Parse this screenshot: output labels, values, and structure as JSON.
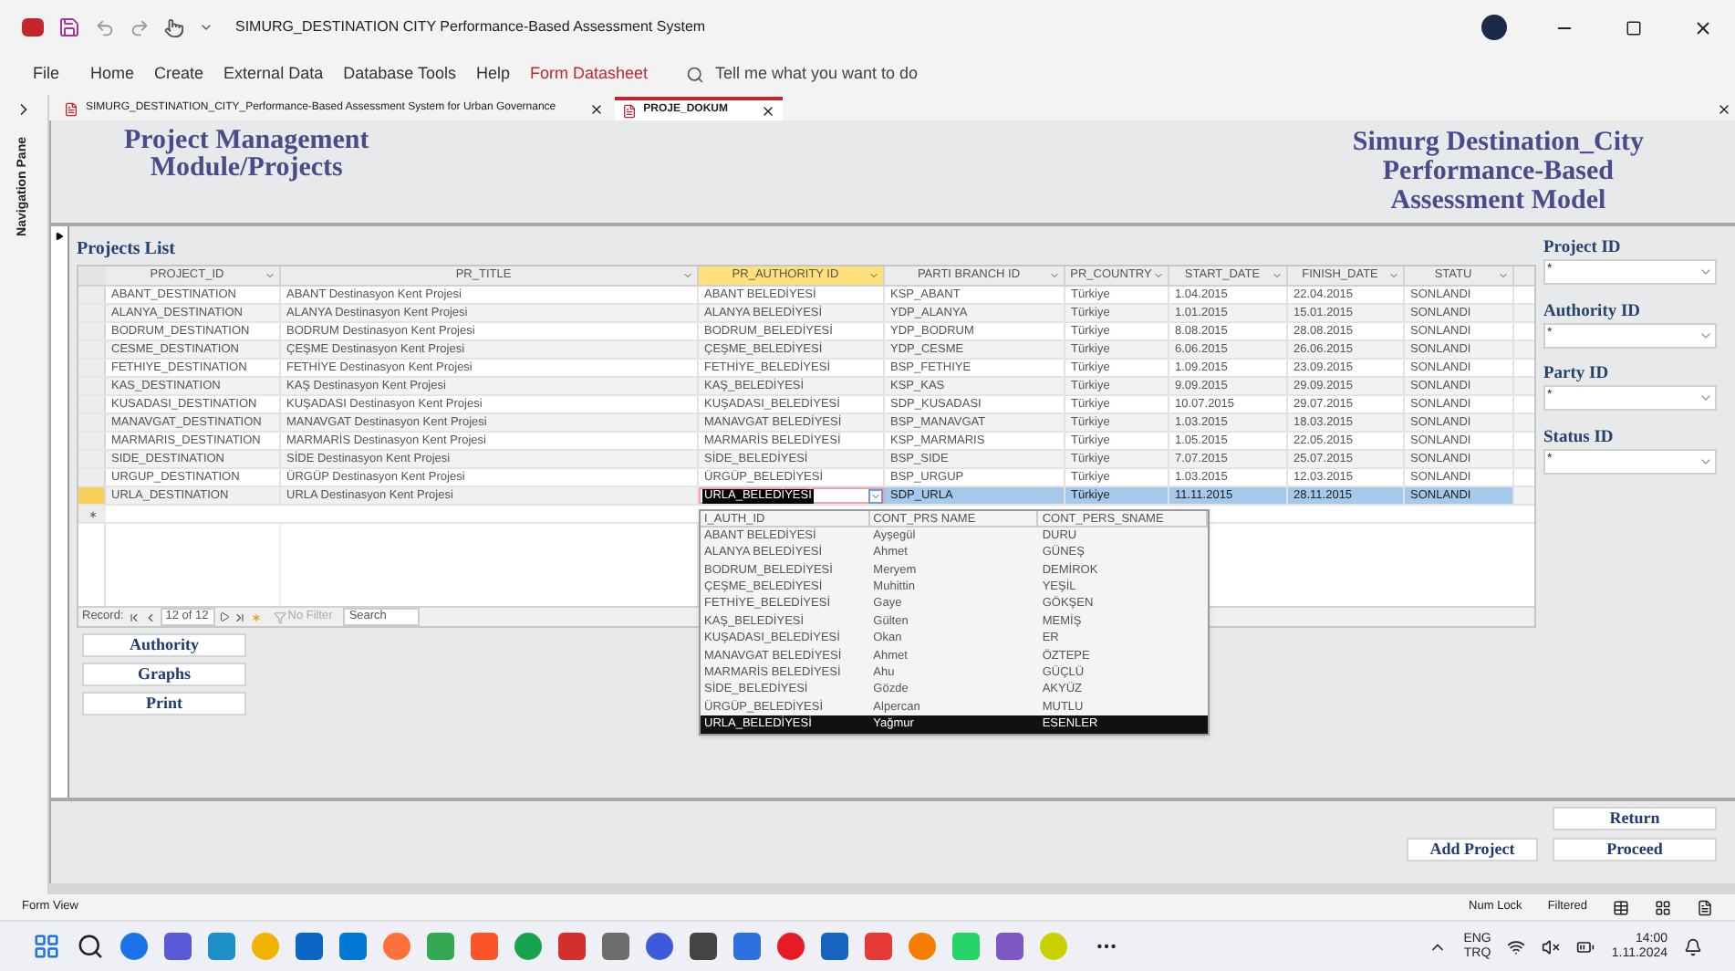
{
  "window": {
    "title": "SIMURG_DESTINATION CITY Performance-Based Assessment System"
  },
  "ribbon": {
    "menu": [
      {
        "label": "File",
        "kind": "tab"
      },
      {
        "label": "Home",
        "kind": "tab"
      },
      {
        "label": "Create",
        "kind": "tab"
      },
      {
        "label": "External Data",
        "kind": "tab"
      },
      {
        "label": "Database Tools",
        "kind": "tab"
      },
      {
        "label": "Help",
        "kind": "tab"
      },
      {
        "label": "Form Datasheet",
        "kind": "contextual"
      }
    ],
    "search": {
      "placeholder": "Tell me what you want to do"
    }
  },
  "navigation_pane": {
    "label": "Navigation Pane"
  },
  "document_tabs": [
    {
      "label": "SIMURG_DESTINATION_CITY_Performance-Based Assessment System for Urban Governance",
      "selected": false
    },
    {
      "label": "PROJE_DOKUM",
      "selected": true
    }
  ],
  "form": {
    "title_left": [
      "Project Management",
      "Module/Projects"
    ],
    "title_right": [
      "Simurg Destination_City",
      "Performance-Based",
      "Assessment Model"
    ],
    "list_heading": "Projects List",
    "table": {
      "columns": [
        {
          "label": "PROJECT_ID",
          "selected": false
        },
        {
          "label": "PR_TITLE",
          "selected": false
        },
        {
          "label": "PR_AUTHORITY ID",
          "selected": true
        },
        {
          "label": "PARTI BRANCH ID",
          "selected": false
        },
        {
          "label": "PR_COUNTRY",
          "selected": false
        },
        {
          "label": "START_DATE",
          "selected": false
        },
        {
          "label": "FINISH_DATE",
          "selected": false
        },
        {
          "label": "STATU",
          "selected": false
        }
      ],
      "rows": [
        {
          "cells": [
            "ABANT_DESTINATION",
            "ABANT Destinasyon Kent Projesi",
            "ABANT BELEDİYESİ",
            "KSP_ABANT",
            "Türkiye",
            "1.04.2015",
            "22.04.2015",
            "SONLANDI"
          ],
          "selected": false
        },
        {
          "cells": [
            "ALANYA_DESTINATION",
            "ALANYA Destinasyon Kent Projesi",
            "ALANYA BELEDİYESİ",
            "YDP_ALANYA",
            "Türkiye",
            "1.01.2015",
            "15.01.2015",
            "SONLANDI"
          ],
          "selected": false
        },
        {
          "cells": [
            "BODRUM_DESTINATION",
            "BODRUM Destinasyon Kent Projesi",
            "BODRUM_BELEDİYESİ",
            "YDP_BODRUM",
            "Türkiye",
            "8.08.2015",
            "28.08.2015",
            "SONLANDI"
          ],
          "selected": false
        },
        {
          "cells": [
            "CESME_DESTINATION",
            "ÇEŞME Destinasyon Kent Projesi",
            "ÇEŞME_BELEDİYESİ",
            "YDP_CESME",
            "Türkiye",
            "6.06.2015",
            "26.06.2015",
            "SONLANDI"
          ],
          "selected": false
        },
        {
          "cells": [
            "FETHIYE_DESTINATION",
            "FETHİYE Destinasyon Kent Projesi",
            "FETHİYE_BELEDİYESİ",
            "BSP_FETHIYE",
            "Türkiye",
            "1.09.2015",
            "23.09.2015",
            "SONLANDI"
          ],
          "selected": false
        },
        {
          "cells": [
            "KAS_DESTINATION",
            "KAŞ Destinasyon Kent Projesi",
            "KAŞ_BELEDİYESİ",
            "KSP_KAS",
            "Türkiye",
            "9.09.2015",
            "29.09.2015",
            "SONLANDI"
          ],
          "selected": false
        },
        {
          "cells": [
            "KUSADASI_DESTINATION",
            "KUŞADASI Destinasyon Kent Projesi",
            "KUŞADASI_BELEDİYESİ",
            "SDP_KUSADASI",
            "Türkiye",
            "10.07.2015",
            "29.07.2015",
            "SONLANDI"
          ],
          "selected": false
        },
        {
          "cells": [
            "MANAVGAT_DESTINATION",
            "MANAVGAT Destinasyon Kent Projesi",
            "MANAVGAT BELEDİYESİ",
            "BSP_MANAVGAT",
            "Türkiye",
            "1.03.2015",
            "18.03.2015",
            "SONLANDI"
          ],
          "selected": false
        },
        {
          "cells": [
            "MARMARIS_DESTINATION",
            "MARMARİS Destinasyon Kent Projesi",
            "MARMARİS BELEDİYESİ",
            "KSP_MARMARIS",
            "Türkiye",
            "1.05.2015",
            "22.05.2015",
            "SONLANDI"
          ],
          "selected": false
        },
        {
          "cells": [
            "SIDE_DESTINATION",
            "SİDE Destinasyon Kent Projesi",
            "SİDE_BELEDİYESİ",
            "BSP_SIDE",
            "Türkiye",
            "7.07.2015",
            "25.07.2015",
            "SONLANDI"
          ],
          "selected": false
        },
        {
          "cells": [
            "URGUP_DESTINATION",
            "ÜRGÜP Destinasyon Kent Projesi",
            "ÜRGÜP_BELEDİYESİ",
            "BSP_URGUP",
            "Türkiye",
            "1.03.2015",
            "12.03.2015",
            "SONLANDI"
          ],
          "selected": false
        },
        {
          "cells": [
            "URLA_DESTINATION",
            "URLA Destinasyon Kent Projesi",
            "URLA_BELEDİYESİ",
            "SDP_URLA",
            "Türkiye",
            "11.11.2015",
            "28.11.2015",
            "SONLANDI"
          ],
          "selected": true
        }
      ],
      "dropdown": {
        "columns": [
          "I_AUTH_ID",
          "CONT_PRS NAME",
          "CONT_PERS_SNAME"
        ],
        "rows": [
          {
            "cells": [
              "ABANT BELEDİYESİ",
              "Ayşegül",
              "DURU"
            ],
            "selected": false
          },
          {
            "cells": [
              "ALANYA BELEDİYESİ",
              "Ahmet",
              "GÜNEŞ"
            ],
            "selected": false
          },
          {
            "cells": [
              "BODRUM_BELEDİYESİ",
              "Meryem",
              "DEMİROK"
            ],
            "selected": false
          },
          {
            "cells": [
              "ÇEŞME_BELEDİYESİ",
              "Muhittin",
              "YEŞİL"
            ],
            "selected": false
          },
          {
            "cells": [
              "FETHİYE_BELEDİYESİ",
              "Gaye",
              "GÖKŞEN"
            ],
            "selected": false
          },
          {
            "cells": [
              "KAŞ_BELEDİYESİ",
              "Gülten",
              "MEMİŞ"
            ],
            "selected": false
          },
          {
            "cells": [
              "KUŞADASI_BELEDİYESİ",
              "Okan",
              "ER"
            ],
            "selected": false
          },
          {
            "cells": [
              "MANAVGAT BELEDİYESİ",
              "Ahmet",
              "ÖZTEPE"
            ],
            "selected": false
          },
          {
            "cells": [
              "MARMARİS BELEDİYESİ",
              "Ahu",
              "GÜÇLÜ"
            ],
            "selected": false
          },
          {
            "cells": [
              "SİDE_BELEDİYESİ",
              "Gözde",
              "AKYÜZ"
            ],
            "selected": false
          },
          {
            "cells": [
              "ÜRGÜP_BELEDİYESİ",
              "Alpercan",
              "MUTLU"
            ],
            "selected": false
          },
          {
            "cells": [
              "URLA_BELEDİYESİ",
              "Yağmur",
              "ESENLER"
            ],
            "selected": true
          }
        ]
      },
      "navigator": {
        "label": "Record:",
        "position": "12 of 12",
        "filter": "No Filter",
        "search": "Search"
      }
    },
    "left_buttons": [
      "Authority",
      "Graphs",
      "Print"
    ],
    "filters": [
      {
        "label": "Project ID",
        "value": "*"
      },
      {
        "label": "Authority ID",
        "value": "*"
      },
      {
        "label": "Party ID",
        "value": "*"
      },
      {
        "label": "Status ID",
        "value": "*"
      }
    ],
    "footer_buttons": {
      "return": "Return",
      "add": "Add Project",
      "proceed": "Proceed"
    }
  },
  "status_bar": {
    "view": "Form View",
    "indicators": [
      "Num Lock",
      "Filtered"
    ]
  },
  "taskbar": {
    "language": [
      "ENG",
      "TRQ"
    ],
    "time": "14:00",
    "date": "1.11.2024"
  }
}
